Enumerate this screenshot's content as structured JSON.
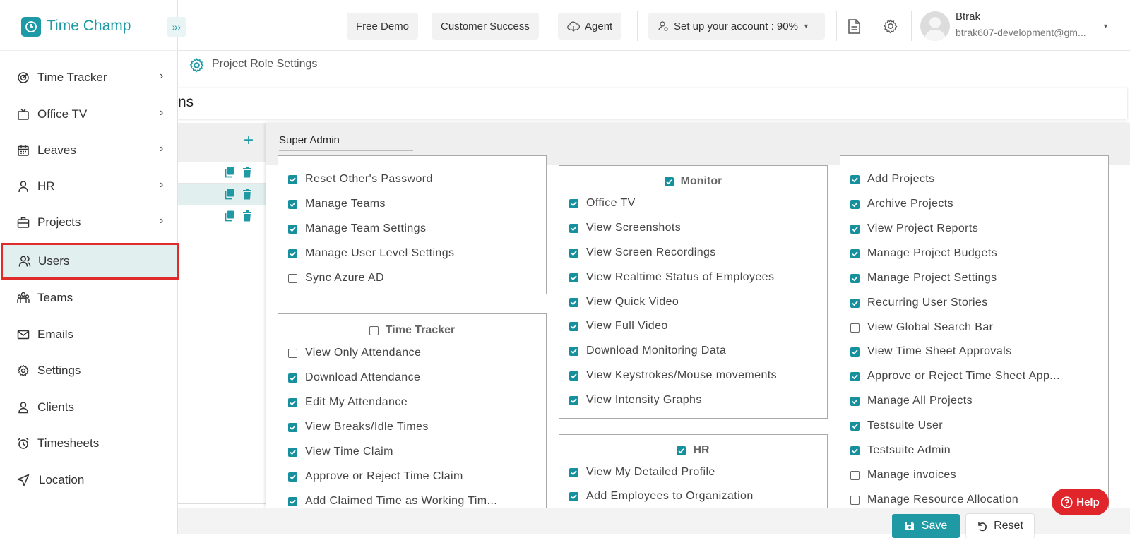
{
  "app": {
    "name": "Time Champ",
    "brand_color": "#1f9aa5",
    "alert_color": "#e0252b"
  },
  "topbar": {
    "free_demo": "Free Demo",
    "customer_success": "Customer Success",
    "agent": "Agent",
    "setup": "Set up your account : 90%",
    "user_name": "Btrak",
    "user_email": "btrak607-development@gm..."
  },
  "sidebar": {
    "items": [
      {
        "label": "Time Tracker",
        "icon": "radar-icon",
        "has_submenu": true
      },
      {
        "label": "Office TV",
        "icon": "tv-icon",
        "has_submenu": true
      },
      {
        "label": "Leaves",
        "icon": "calendar-icon",
        "has_submenu": true
      },
      {
        "label": "HR",
        "icon": "person-icon",
        "has_submenu": true
      },
      {
        "label": "Projects",
        "icon": "briefcase-icon",
        "has_submenu": true
      },
      {
        "label": "Users",
        "icon": "users-icon",
        "has_submenu": false,
        "active": true
      },
      {
        "label": "Teams",
        "icon": "team-icon",
        "has_submenu": false
      },
      {
        "label": "Emails",
        "icon": "mail-icon",
        "has_submenu": false
      },
      {
        "label": "Settings",
        "icon": "gear-icon",
        "has_submenu": false
      },
      {
        "label": "Clients",
        "icon": "client-icon",
        "has_submenu": false
      },
      {
        "label": "Timesheets",
        "icon": "alarm-icon",
        "has_submenu": false
      },
      {
        "label": "Location",
        "icon": "location-arrow-icon",
        "has_submenu": false
      }
    ]
  },
  "breadcrumb": {
    "label": "Project Role Settings"
  },
  "page_header": {
    "title_fragment": "ns"
  },
  "role_editor": {
    "role_name": "Super Admin",
    "groups": {
      "col1_top": {
        "items": [
          {
            "label": "Reset Other's Password",
            "checked": true
          },
          {
            "label": "Manage Teams",
            "checked": true
          },
          {
            "label": "Manage Team Settings",
            "checked": true
          },
          {
            "label": "Manage User Level Settings",
            "checked": true
          },
          {
            "label": "Sync Azure AD",
            "checked": false
          }
        ]
      },
      "time_tracker": {
        "title": "Time Tracker",
        "checked": false,
        "items": [
          {
            "label": "View Only Attendance",
            "checked": false
          },
          {
            "label": "Download Attendance",
            "checked": true
          },
          {
            "label": "Edit My Attendance",
            "checked": true
          },
          {
            "label": "View Breaks/Idle Times",
            "checked": true
          },
          {
            "label": "View Time Claim",
            "checked": true
          },
          {
            "label": "Approve or Reject Time Claim",
            "checked": true
          },
          {
            "label": "Add Claimed Time as Working Tim...",
            "checked": true
          }
        ]
      },
      "monitor": {
        "title": "Monitor",
        "checked": true,
        "items": [
          {
            "label": "Office TV",
            "checked": true
          },
          {
            "label": "View Screenshots",
            "checked": true
          },
          {
            "label": "View Screen Recordings",
            "checked": true
          },
          {
            "label": "View Realtime Status of Employees",
            "checked": true
          },
          {
            "label": "View Quick Video",
            "checked": true
          },
          {
            "label": "View Full Video",
            "checked": true
          },
          {
            "label": "Download Monitoring Data",
            "checked": true
          },
          {
            "label": "View Keystrokes/Mouse movements",
            "checked": true
          },
          {
            "label": "View Intensity Graphs",
            "checked": true
          }
        ]
      },
      "hr": {
        "title": "HR",
        "checked": true,
        "items": [
          {
            "label": "View My Detailed Profile",
            "checked": true
          },
          {
            "label": "Add Employees to Organization",
            "checked": true
          }
        ]
      },
      "projects": {
        "items": [
          {
            "label": "Add Projects",
            "checked": true
          },
          {
            "label": "Archive Projects",
            "checked": true
          },
          {
            "label": "View Project Reports",
            "checked": true
          },
          {
            "label": "Manage Project Budgets",
            "checked": true
          },
          {
            "label": "Manage Project Settings",
            "checked": true
          },
          {
            "label": "Recurring User Stories",
            "checked": true
          },
          {
            "label": "View Global Search Bar",
            "checked": false
          },
          {
            "label": "View Time Sheet Approvals",
            "checked": true
          },
          {
            "label": "Approve or Reject Time Sheet App...",
            "checked": true
          },
          {
            "label": "Manage All Projects",
            "checked": true
          },
          {
            "label": "Testsuite User",
            "checked": true
          },
          {
            "label": "Testsuite Admin",
            "checked": true
          },
          {
            "label": "Manage invoices",
            "checked": false
          },
          {
            "label": "Manage Resource Allocation",
            "checked": false
          }
        ]
      }
    }
  },
  "actions": {
    "save": "Save",
    "reset": "Reset",
    "help": "Help"
  }
}
